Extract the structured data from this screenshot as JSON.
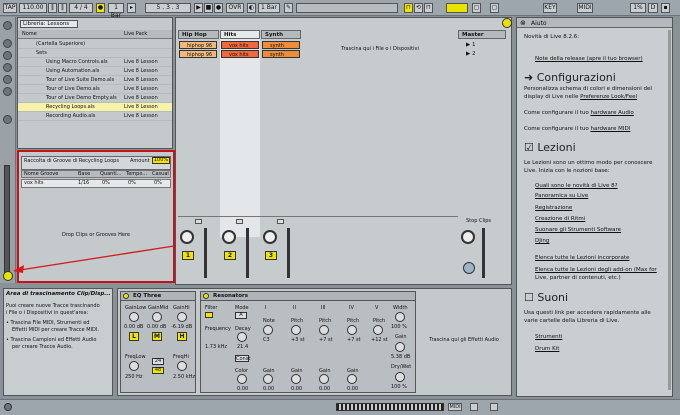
{
  "transport": {
    "tap": "TAP",
    "tempo": "110.00",
    "sig": "4 / 4",
    "quant": "1 Bar",
    "pos": "5 . 3 . 3",
    "ovr": "OVR",
    "key": "KEY",
    "midi": "MIDI",
    "zoom": "1%",
    "d": "D"
  },
  "browser": {
    "title": "Libreria: Lessons",
    "col2": "Live Pack",
    "rows": [
      {
        "name": "(Cartella Superiore)",
        "kind": ""
      },
      {
        "name": "Sets",
        "kind": ""
      },
      {
        "name": "Using Macro Controls.als",
        "kind": "Live 8 Lesson"
      },
      {
        "name": "Using Automation.als",
        "kind": "Live 8 Lesson"
      },
      {
        "name": "Tour of Live Suite Demo.als",
        "kind": "Live 8 Lesson"
      },
      {
        "name": "Tour of Live Demo.als",
        "kind": "Live 8 Lesson"
      },
      {
        "name": "Tour of Live Demo Empty.als",
        "kind": "Live 8 Lesson"
      },
      {
        "name": "Recycling Loops.als",
        "kind": "Live 8 Lesson"
      },
      {
        "name": "Recording Audio.als",
        "kind": "Live 8 Lesson"
      }
    ]
  },
  "groove": {
    "title": "Raccolta di Groove di Recycling Loops",
    "amount_label": "Amount",
    "amount": "100%",
    "headers": [
      "Nome Groove",
      "Base",
      "Quanti...",
      "Tempo...",
      "Casual"
    ],
    "row": [
      "vox hits",
      "1/16",
      "0%",
      "0%",
      "0%"
    ],
    "drop": "Drop Clips or Grooves Here"
  },
  "session": {
    "tracks": [
      "Hip Hop",
      "Hits",
      "Synth"
    ],
    "master": "Master",
    "drop": "Trascina qui i File o i Dispositivi",
    "stop": "Stop Clips",
    "clips": [
      "hiphop 96",
      "hiphop 96",
      "vox hits",
      "vox hits",
      "synth",
      "synth"
    ],
    "scenes": [
      "1",
      "2"
    ],
    "nums": [
      "1",
      "2",
      "3"
    ]
  },
  "help": {
    "title": "Aiuto",
    "intro": "Novità di Live 8.2.6:",
    "note": "Note della release (apre il tuo browser)",
    "h1": "Configurazioni",
    "p1a": "Personalizza schema di colori e dimensioni del",
    "p1b": "display di Live nelle",
    "p1link": "Preferenze Look/Feel",
    "p2a": "Come configurare il tuo",
    "p2link": "hardware Audio",
    "p3a": "Come configurare il tuo",
    "p3link": "hardware MIDI",
    "h2": "Lezioni",
    "p4a": "Le Lezioni sono un ottimo modo per conoscere",
    "p4b": "Live. Inizia con le nozioni base:",
    "links1": [
      "Quali sono le novità di Live 8?",
      "Panoramica su Live",
      "Registrazione",
      "Creazione di Ritmi",
      "Suonare gli Strumenti Software",
      "DJing"
    ],
    "links2": [
      "Elenca tutte le Lezioni incorporate",
      "Elenca tutte le Lezioni degli add-on (Max for",
      "Live, partner di contenuti, etc.)"
    ],
    "h3": "Suoni",
    "p5a": "Usa questi link per accedere rapidamente alle",
    "p5b": "varie cartelle della Libreria di Live.",
    "links3": [
      "Strumenti",
      "Drum Kit"
    ]
  },
  "info": {
    "title": "Area di trascinamento Clip/Disp...",
    "lines": [
      "Puoi creare nuove Tracce trascinando",
      "i File o i Dispositivi in quest'area:"
    ],
    "bullets": [
      [
        "Trascina File MIDI, Strumenti ed",
        "Effetti MIDI per creare Tracce MIDI."
      ],
      [
        "Trascina Campioni ed Effetti Audio",
        "per creare Tracce Audio."
      ]
    ]
  },
  "eq": {
    "title": "EQ Three",
    "labels": [
      "GainLow",
      "GainMid",
      "GainHi"
    ],
    "vals": [
      "0.00 dB",
      "0.00 dB",
      "-6.19 dB"
    ],
    "btns": [
      "L",
      "M",
      "H"
    ],
    "fl": "FreqLow",
    "flv": "250 Hz",
    "fh": "FreqHi",
    "fhv": "2.50 kHz",
    "s1": "24",
    "s2": "48"
  },
  "res": {
    "title": "Resonators",
    "filter": "Filter",
    "mode": "Mode",
    "modeval": "A",
    "freq": "Frequency",
    "freqv": "1.73 kHz",
    "cols": [
      "I",
      "II",
      "III",
      "IV",
      "V"
    ],
    "decay": "Decay",
    "decayv": "21.4",
    "note": "Note",
    "notev": "C3",
    "pitch": [
      "Pitch",
      "Pitch",
      "Pitch",
      "Pitch"
    ],
    "pitchv": [
      "+3 st",
      "+7 st",
      "+7 st",
      "+12 st"
    ],
    "const": "Const",
    "constv": "2.56",
    "width": "Width",
    "widthv": "100 %",
    "gain": "Gain",
    "gainv": "5.38 dB",
    "color": "Color",
    "colorv": "0.00",
    "gains": [
      "Gain",
      "Gain",
      "Gain",
      "Gain"
    ],
    "gainsv": [
      "0.00",
      "0.00",
      "0.00",
      "0.00"
    ],
    "dw": "Dry/Wet",
    "dwv": "100 %",
    "dropfx": "Trascina qui gli Effetti Audio"
  }
}
